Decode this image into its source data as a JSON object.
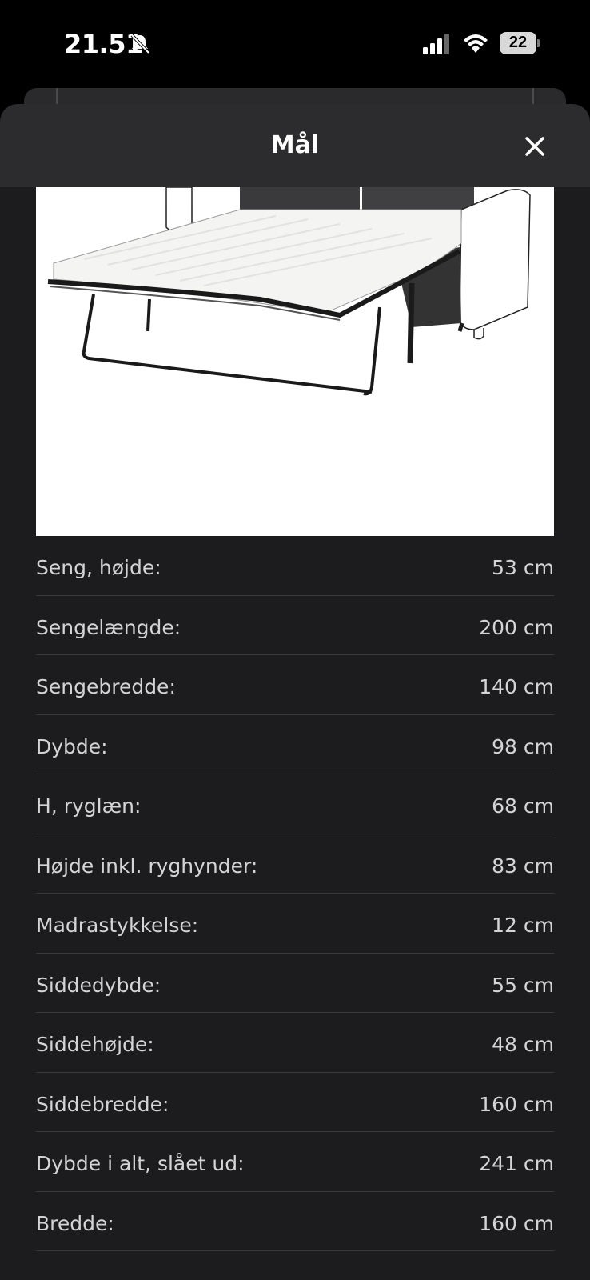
{
  "status_bar": {
    "time": "21.51",
    "battery": "22"
  },
  "sheet": {
    "title": "Mål",
    "close_icon": "close-icon"
  },
  "dimensions": [
    {
      "label": "Seng, højde:",
      "value": "53 cm"
    },
    {
      "label": "Sengelængde:",
      "value": "200 cm"
    },
    {
      "label": "Sengebredde:",
      "value": "140 cm"
    },
    {
      "label": "Dybde:",
      "value": "98 cm"
    },
    {
      "label": "H, ryglæn:",
      "value": "68 cm"
    },
    {
      "label": "Højde inkl. ryghynder:",
      "value": "83 cm"
    },
    {
      "label": "Madrastykkelse:",
      "value": "12 cm"
    },
    {
      "label": "Siddedybde:",
      "value": "55 cm"
    },
    {
      "label": "Siddehøjde:",
      "value": "48 cm"
    },
    {
      "label": "Siddebredde:",
      "value": "160 cm"
    },
    {
      "label": "Dybde i alt, slået ud:",
      "value": "241 cm"
    },
    {
      "label": "Bredde:",
      "value": "160 cm"
    }
  ]
}
